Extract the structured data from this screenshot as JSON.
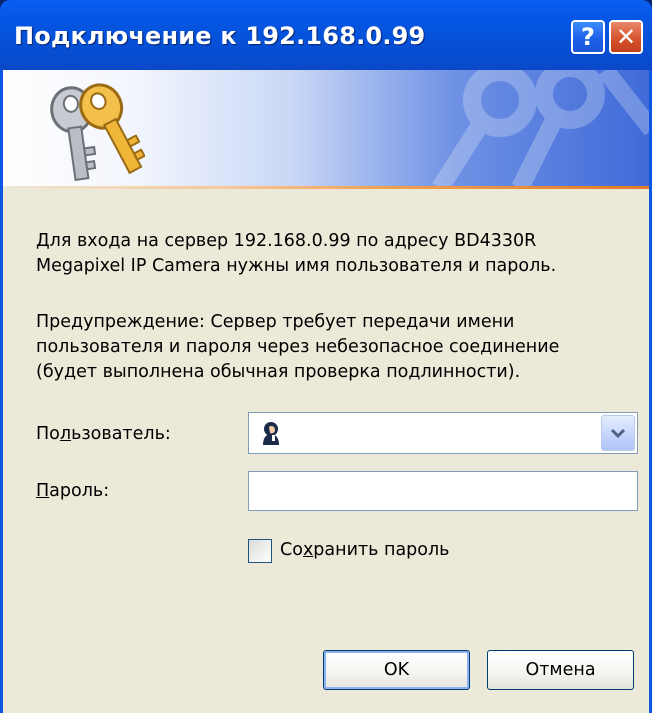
{
  "window": {
    "title": "Подключение к 192.168.0.99",
    "help_label": "?",
    "close_label": "✕"
  },
  "message": {
    "line1": "Для входа на сервер 192.168.0.99 по адресу BD4330R",
    "line2": "Megapixel IP Camera нужны имя пользователя и пароль.",
    "warning1": "Предупреждение: Сервер требует передачи имени",
    "warning2": "пользователя и пароля через небезопасное соединение",
    "warning3": "(будет выполнена обычная проверка подлинности)."
  },
  "form": {
    "user_label_pre": "По",
    "user_label_u": "л",
    "user_label_post": "ьзователь:",
    "user_value": "",
    "password_label_u": "П",
    "password_label_post": "ароль:",
    "password_value": "",
    "remember_pre": "Со",
    "remember_u": "х",
    "remember_post": "ранить пароль",
    "remember_checked": false
  },
  "buttons": {
    "ok": "OK",
    "cancel": "Отмена"
  },
  "icons": {
    "banner": "keys-icon",
    "user": "user-icon",
    "dropdown": "chevron-down-icon"
  },
  "colors": {
    "titlebar": "#0452d9",
    "client_bg": "#ece9d8",
    "close": "#d6542e",
    "accent_line": "#f19f4d"
  }
}
